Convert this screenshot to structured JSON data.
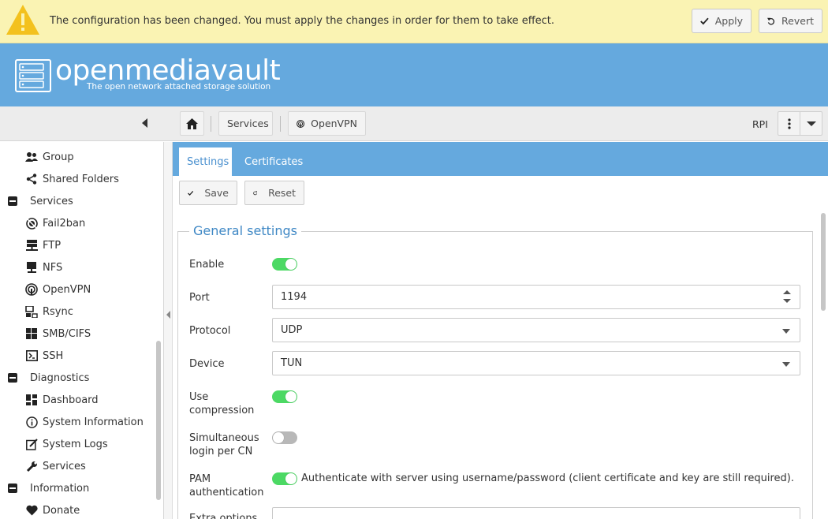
{
  "notification": {
    "message": "The configuration has been changed. You must apply the changes in order for them to take effect.",
    "apply_label": "Apply",
    "revert_label": "Revert",
    "icon": "warning-icon",
    "color": "#faf3b3"
  },
  "header": {
    "title": "openmediavault",
    "subtitle": "The open network attached storage solution",
    "color": "#65a9de"
  },
  "breadcrumb": {
    "home_icon": "home-icon",
    "items": [
      "Services",
      "OpenVPN"
    ]
  },
  "toolbar": {
    "host": "RPI"
  },
  "sidebar": {
    "items": [
      {
        "label": "Group",
        "icon": "group-icon",
        "level": "child"
      },
      {
        "label": "Shared Folders",
        "icon": "share-icon",
        "level": "child"
      },
      {
        "label": "Services",
        "icon": "collapse-icon",
        "level": "parent"
      },
      {
        "label": "Fail2ban",
        "icon": "fail2ban-icon",
        "level": "child"
      },
      {
        "label": "FTP",
        "icon": "ftp-icon",
        "level": "child"
      },
      {
        "label": "NFS",
        "icon": "nfs-icon",
        "level": "child"
      },
      {
        "label": "OpenVPN",
        "icon": "openvpn-icon",
        "level": "child"
      },
      {
        "label": "Rsync",
        "icon": "rsync-icon",
        "level": "child"
      },
      {
        "label": "SMB/CIFS",
        "icon": "windows-icon",
        "level": "child"
      },
      {
        "label": "SSH",
        "icon": "terminal-icon",
        "level": "child"
      },
      {
        "label": "Diagnostics",
        "icon": "collapse-icon",
        "level": "parent"
      },
      {
        "label": "Dashboard",
        "icon": "dashboard-icon",
        "level": "child"
      },
      {
        "label": "System Information",
        "icon": "info-icon",
        "level": "child"
      },
      {
        "label": "System Logs",
        "icon": "logs-icon",
        "level": "child"
      },
      {
        "label": "Services",
        "icon": "wrench-icon",
        "level": "child"
      },
      {
        "label": "Information",
        "icon": "collapse-icon",
        "level": "parent"
      },
      {
        "label": "Donate",
        "icon": "heart-icon",
        "level": "child"
      }
    ]
  },
  "tabs": [
    {
      "label": "Settings",
      "active": true
    },
    {
      "label": "Certificates",
      "active": false
    }
  ],
  "actions": {
    "save_label": "Save",
    "reset_label": "Reset"
  },
  "form": {
    "legend": "General settings",
    "enable": {
      "label": "Enable",
      "value": true
    },
    "port": {
      "label": "Port",
      "value": "1194"
    },
    "protocol": {
      "label": "Protocol",
      "value": "UDP"
    },
    "device": {
      "label": "Device",
      "value": "TUN"
    },
    "compression": {
      "label_line1": "Use",
      "label_line2": "compression",
      "value": true
    },
    "simultaneous": {
      "label_line1": "Simultaneous",
      "label_line2": "login per CN",
      "value": false
    },
    "pam": {
      "label_line1": "PAM",
      "label_line2": "authentication",
      "value": true,
      "description": "Authenticate with server using username/password (client certificate and key are still required)."
    },
    "extra_options": {
      "label": "Extra options"
    }
  },
  "colors": {
    "accent": "#65a9de",
    "toggle_on": "#4cd964",
    "toggle_off": "#b8b8b8",
    "legend": "#3f88c5"
  }
}
